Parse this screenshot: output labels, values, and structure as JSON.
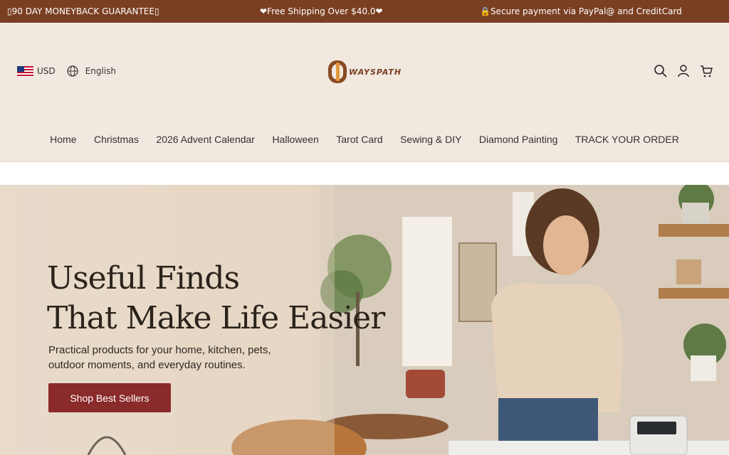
{
  "announcement": {
    "guarantee": "▯90 DAY MONEYBACK GUARANTEE▯",
    "shipping": "❤Free Shipping Over $40.0❤",
    "payment": "🔒Secure payment via PayPal@ and CreditCard"
  },
  "header": {
    "currency": "USD",
    "language": "English",
    "logo_text": "WAYSPATH",
    "icons": [
      "search-icon",
      "account-icon",
      "cart-icon"
    ]
  },
  "nav": {
    "items": [
      "Home",
      "Christmas",
      "2026 Advent Calendar",
      "Halloween",
      "Tarot Card",
      "Sewing & DIY",
      "Diamond Painting",
      "TRACK YOUR ORDER"
    ]
  },
  "hero": {
    "title_line1": "Useful Finds",
    "title_line2": "That Make Life Easier",
    "subtitle_line1": "Practical products for your home, kitchen, pets,",
    "subtitle_line2": "outdoor moments, and everyday routines.",
    "button": "Shop Best Sellers"
  },
  "colors": {
    "topbar": "#7a3f22",
    "header_bg": "#f1e8df",
    "button": "#8a2a2a",
    "title": "#2b231c"
  }
}
